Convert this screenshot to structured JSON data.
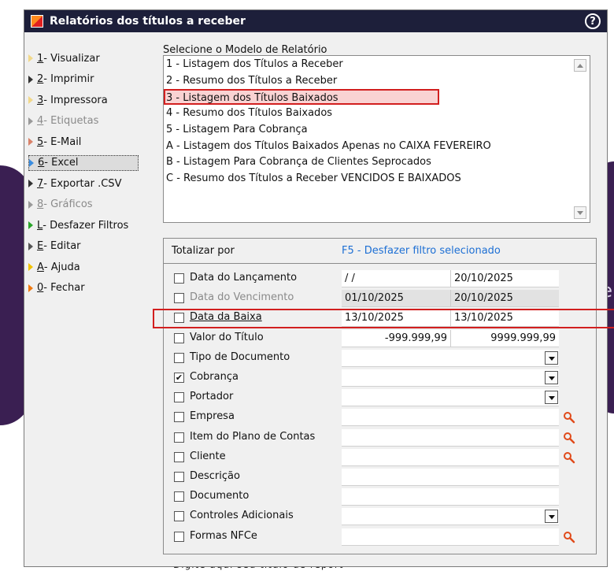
{
  "window": {
    "title": "Relatórios dos títulos a receber"
  },
  "background": {
    "letter": "e",
    "bottom_text": "Digite aqui seu título de report"
  },
  "menu": [
    {
      "key": "1",
      "label": " - Visualizar",
      "color": "#f2d98a",
      "state": "normal"
    },
    {
      "key": "2",
      "label": " - Imprimir",
      "color": "#333333",
      "state": "normal"
    },
    {
      "key": "3",
      "label": " - Impressora",
      "color": "#f2d98a",
      "state": "normal"
    },
    {
      "key": "4",
      "label": " - Etiquetas",
      "color": "#9a9a9a",
      "state": "disabled"
    },
    {
      "key": "5",
      "label": " - E-Mail",
      "color": "#d9826a",
      "state": "normal"
    },
    {
      "key": "6",
      "label": " - Excel",
      "color": "#3a8de0",
      "state": "selected"
    },
    {
      "key": "7",
      "label": " - Exportar .CSV",
      "color": "#333333",
      "state": "normal"
    },
    {
      "key": "8",
      "label": " - Gráficos",
      "color": "#9a9a9a",
      "state": "disabled"
    },
    {
      "key": "L",
      "label": " - Desfazer Filtros",
      "color": "#2aa52a",
      "state": "normal"
    },
    {
      "key": "E",
      "label": " - Editar",
      "color": "#555555",
      "state": "normal"
    },
    {
      "key": "A",
      "label": " - Ajuda",
      "color": "#f2c200",
      "state": "normal"
    },
    {
      "key": "0",
      "label": " - Fechar",
      "color": "#f07a10",
      "state": "normal"
    }
  ],
  "model": {
    "label": "Selecione o Modelo de Relatório",
    "items": [
      "1 - Listagem dos Títulos a Receber",
      "2 - Resumo dos Títulos a Receber",
      "3 - Listagem dos Títulos Baixados",
      "4 - Resumo dos Títulos Baixados",
      "5 - Listagem Para Cobrança",
      "A - Listagem dos Títulos Baixados Apenas no CAIXA FEVEREIRO",
      "B - Listagem Para Cobrança de Clientes Seprocados",
      "C - Resumo dos Títulos a Receber VENCIDOS E BAIXADOS"
    ],
    "selected_index": 2
  },
  "filters": {
    "header_left": "Totalizar por",
    "header_right": "F5 - Desfazer filtro selecionado",
    "rows": [
      {
        "label": "Data do Lançamento",
        "checked": false,
        "type": "range",
        "v1": " / /",
        "v2": "20/10/2025"
      },
      {
        "label": "Data do Vencimento",
        "checked": false,
        "type": "range",
        "disabled": true,
        "v1": "01/10/2025",
        "v2": "20/10/2025"
      },
      {
        "label": "Data da Baixa",
        "checked": false,
        "type": "range",
        "underline": true,
        "v1": "13/10/2025",
        "v2": "13/10/2025"
      },
      {
        "label": "Valor do Título",
        "checked": false,
        "type": "range",
        "align": "right",
        "v1": "-999.999,99",
        "v2": "9999.999,99"
      },
      {
        "label": "Tipo de Documento",
        "checked": false,
        "type": "dropdown"
      },
      {
        "label": "Cobrança",
        "checked": true,
        "type": "dropdown"
      },
      {
        "label": "Portador",
        "checked": false,
        "type": "dropdown"
      },
      {
        "label": "Empresa",
        "checked": false,
        "type": "search"
      },
      {
        "label": "Item do Plano de Contas",
        "checked": false,
        "type": "search"
      },
      {
        "label": "Cliente",
        "checked": false,
        "type": "search"
      },
      {
        "label": "Descrição",
        "checked": false,
        "type": "none"
      },
      {
        "label": "Documento",
        "checked": false,
        "type": "none"
      },
      {
        "label": "Controles Adicionais",
        "checked": false,
        "type": "dropdown"
      },
      {
        "label": "Formas NFCe",
        "checked": false,
        "type": "text-search"
      }
    ],
    "checkmark": "✔"
  }
}
